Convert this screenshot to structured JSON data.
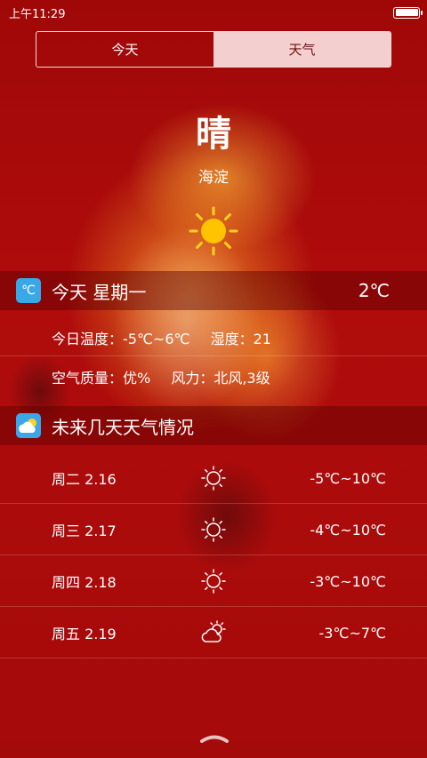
{
  "status_bar": {
    "time": "上午11:29"
  },
  "tabs": [
    {
      "label": "今天"
    },
    {
      "label": "天气"
    }
  ],
  "current": {
    "condition": "晴",
    "location": "海淀",
    "icon": "sun-icon"
  },
  "today": {
    "title": "今天 星期一",
    "temperature": "2℃",
    "icon": "thermometer-celsius-icon",
    "temp_range": "今日温度：-5℃~6℃",
    "humidity": "湿度：21",
    "air_quality": "空气质量：优%",
    "wind": "风力：北风,3级"
  },
  "future": {
    "title": "未来几天天气情况",
    "icon": "cloud-sun-icon",
    "days": [
      {
        "day": "周二 2.16",
        "icon": "sun-icon",
        "range": "-5℃~10℃"
      },
      {
        "day": "周三 2.17",
        "icon": "sun-icon",
        "range": "-4℃~10℃"
      },
      {
        "day": "周四 2.18",
        "icon": "sun-icon",
        "range": "-3℃~10℃"
      },
      {
        "day": "周五 2.19",
        "icon": "cloudy-icon",
        "range": "-3℃~7℃"
      }
    ]
  },
  "colors": {
    "background": "#a50a0a",
    "tab_inactive": "#fae1e1",
    "accent_icon": "#3aa8e8"
  }
}
